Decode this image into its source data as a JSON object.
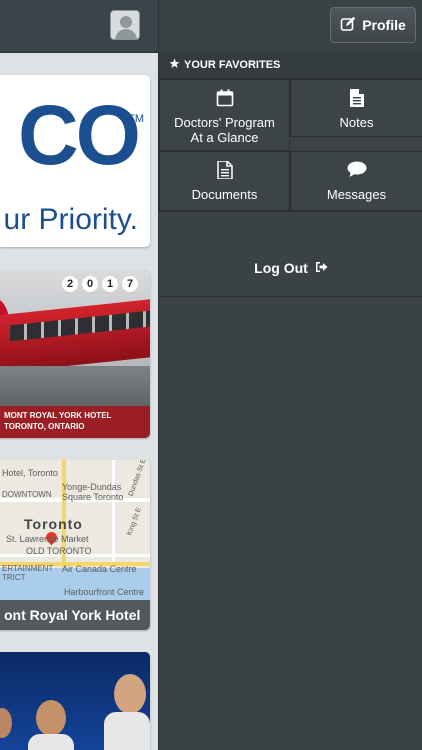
{
  "drawer": {
    "profile_label": "Profile",
    "favorites_header": "YOUR FAVORITES",
    "tiles": [
      {
        "label_line1": "Doctors' Program",
        "label_line2": "At a Glance",
        "icon": "calendar-icon"
      },
      {
        "label_line1": "Notes",
        "label_line2": "",
        "icon": "document-icon"
      },
      {
        "label_line1": "Documents",
        "label_line2": "",
        "icon": "document-icon"
      },
      {
        "label_line1": "Messages",
        "label_line2": "",
        "icon": "chat-bubble-icon"
      }
    ],
    "logout_label": "Log Out"
  },
  "content": {
    "logo_text": "CO",
    "logo_tm": "TM",
    "logo_tagline": "ur Priority.",
    "event_year": [
      "2",
      "0",
      "1",
      "7"
    ],
    "event_banner_line1": "MONT ROYAL YORK HOTEL",
    "event_banner_line2": "TORONTO, ONTARIO",
    "map_labels": {
      "hotel": "Hotel, Toronto",
      "downtown": "DOWNTOWN",
      "yonge": "Yonge-Dundas",
      "square": "Square Toronto",
      "city": "Toronto",
      "market": "St. Lawrence Market",
      "old": "OLD TORONTO",
      "ent": "ERTAINMENT",
      "district": "TRICT",
      "aircanada": "Air Canada Centre",
      "harbour": "Harbourfront Centre",
      "dundas": "Dundas St E",
      "king": "King St E"
    },
    "map_caption": "ont Royal York Hotel"
  },
  "colors": {
    "drawer_bg": "#3a4246",
    "accent_red": "#c8102e",
    "logo_blue": "#1b4f8f"
  }
}
